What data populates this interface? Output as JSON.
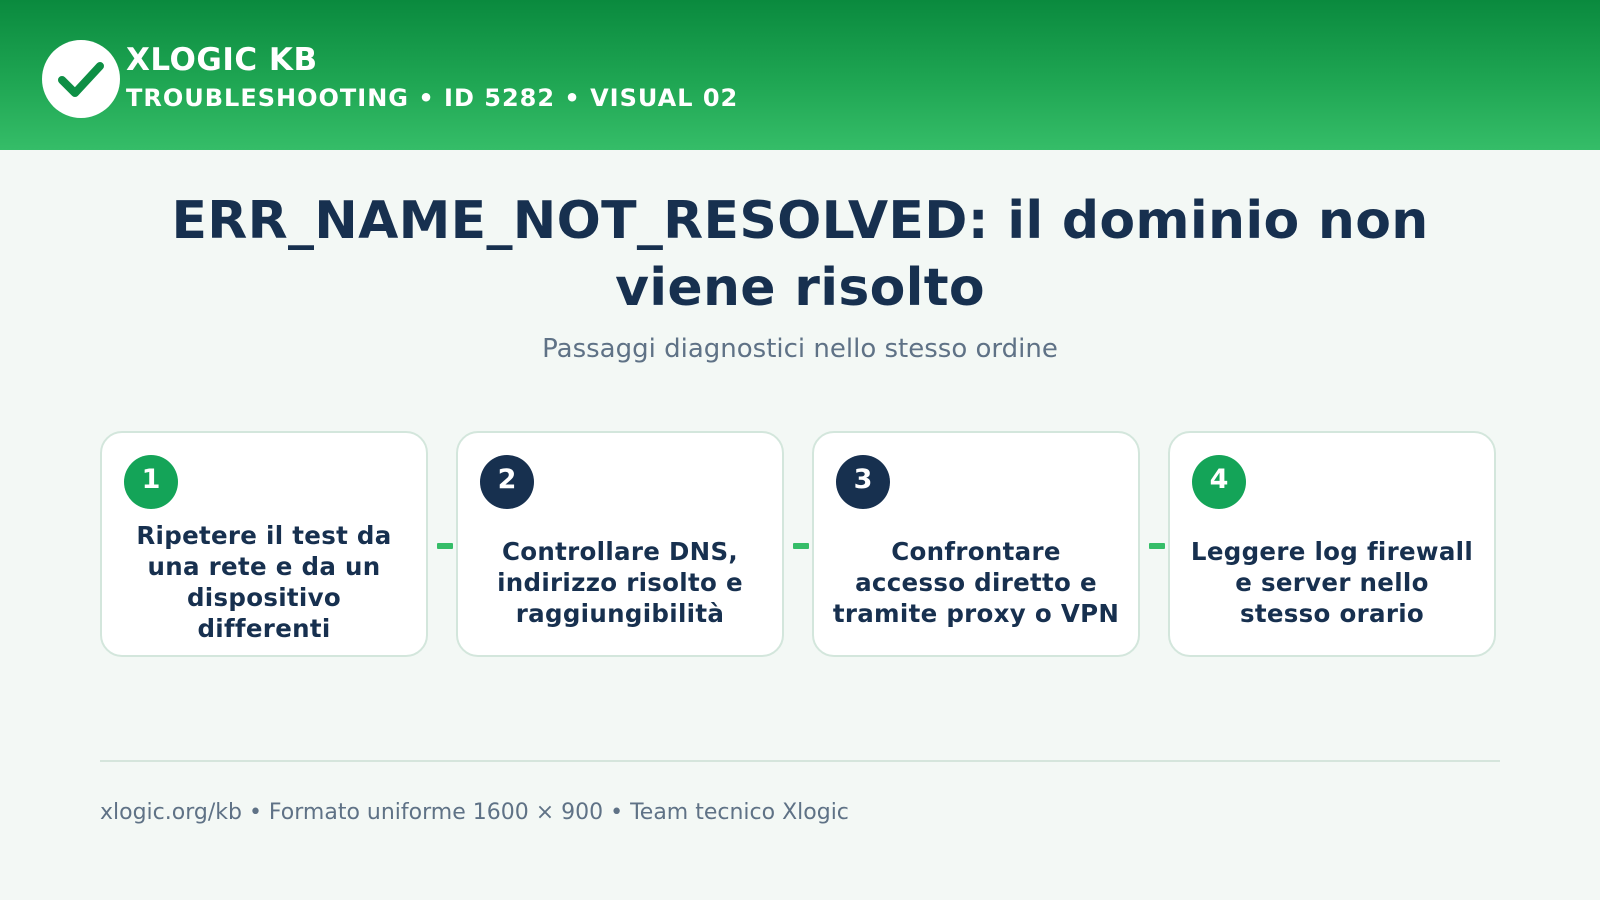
{
  "header": {
    "logo_icon": "checkmark-icon",
    "brand": "XLOGIC KB",
    "subtitle": "TROUBLESHOOTING • ID 5282 • VISUAL 02"
  },
  "main": {
    "title": "ERR_NAME_NOT_RESOLVED: il dominio non viene risolto",
    "subtitle": "Passaggi diagnostici nello stesso ordine"
  },
  "steps": [
    {
      "number": "1",
      "text": "Ripetere il test da una rete e da un dispositivo differenti",
      "badge_color": "#14a458"
    },
    {
      "number": "2",
      "text": "Controllare DNS, indirizzo risolto e raggiungibilità",
      "badge_color": "#17304f"
    },
    {
      "number": "3",
      "text": "Confrontare accesso diretto e tramite proxy o VPN",
      "badge_color": "#17304f"
    },
    {
      "number": "4",
      "text": "Leggere log firewall e server nello stesso orario",
      "badge_color": "#14a458"
    }
  ],
  "footer": {
    "text": "xlogic.org/kb • Formato uniforme 1600 × 900 • Team tecnico Xlogic"
  },
  "colors": {
    "header_green": "#1fa653",
    "accent_green": "#35bd68",
    "navy": "#17304f",
    "muted_text": "#5f7286",
    "background": "#f3f8f5"
  }
}
